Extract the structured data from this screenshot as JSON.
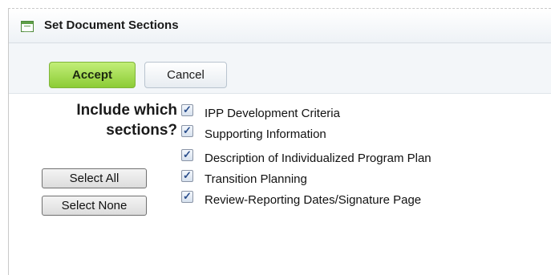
{
  "dialog": {
    "title": "Set Document Sections",
    "icon": "document-list-icon"
  },
  "toolbar": {
    "accept_label": "Accept",
    "cancel_label": "Cancel",
    "accept_color": "#8ccc36"
  },
  "prompt": {
    "line1": "Include which",
    "line2": "sections?"
  },
  "buttons": {
    "select_all": "Select All",
    "select_none": "Select None"
  },
  "sections": [
    {
      "label": "IPP Development Criteria",
      "checked": true
    },
    {
      "label": "Supporting Information",
      "checked": true
    },
    {
      "label": "Description of Individualized Program Plan",
      "checked": true
    },
    {
      "label": "Transition Planning",
      "checked": true
    },
    {
      "label": "Review-Reporting Dates/Signature Page",
      "checked": true
    }
  ]
}
